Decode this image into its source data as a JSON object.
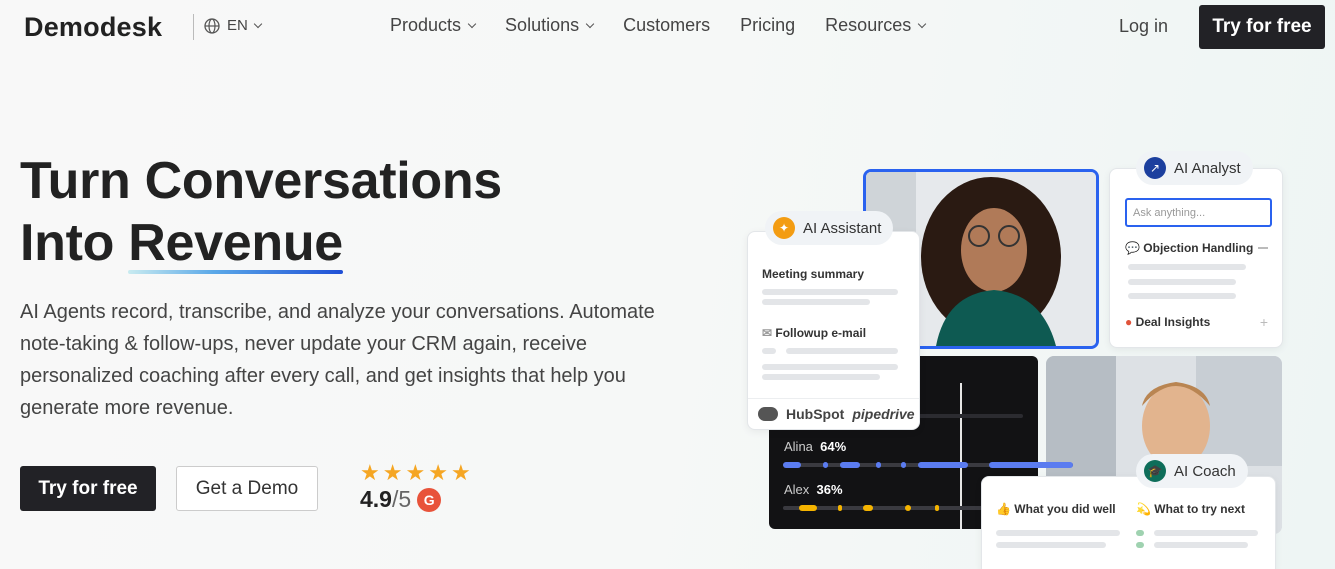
{
  "nav": {
    "logo": "Demodesk",
    "lang": "EN",
    "items": [
      {
        "label": "Products",
        "dropdown": true
      },
      {
        "label": "Solutions",
        "dropdown": true
      },
      {
        "label": "Customers",
        "dropdown": false
      },
      {
        "label": "Pricing",
        "dropdown": false
      },
      {
        "label": "Resources",
        "dropdown": true
      }
    ],
    "login": "Log in",
    "cta": "Try for free"
  },
  "hero": {
    "title_line1": "Turn Conversations",
    "title_line2_prefix": "Into ",
    "title_line2_highlight": "Revenue",
    "description": "AI Agents record, transcribe, and analyze your conversations. Automate note-taking & follow-ups, never update your CRM again, receive personalized coaching after every call, and get insights that help you generate more revenue.",
    "cta_primary": "Try for free",
    "cta_secondary": "Get a Demo",
    "rating_score": "4.9",
    "rating_out_of": "/5",
    "rating_stars": 5,
    "rating_badge": "G"
  },
  "assistant": {
    "pill": "AI Assistant",
    "meeting_summary": "Meeting summary",
    "followup": "Followup e-mail",
    "integrations": [
      "HubSpot",
      "pipedrive"
    ]
  },
  "analyst": {
    "pill": "AI Analyst",
    "placeholder": "Ask anything...",
    "objection": "Objection Handling",
    "deal": "Deal Insights"
  },
  "speakers": [
    {
      "name": "Alina",
      "pct": "64%"
    },
    {
      "name": "Alex",
      "pct": "36%"
    }
  ],
  "coach": {
    "pill": "AI Coach",
    "did_well": "What you did well",
    "try_next": "What to try next"
  },
  "colors": {
    "accent_blue": "#1f4fd6",
    "dark": "#222226",
    "alina_track": "#5b7cf0",
    "alex_track": "#f5b400",
    "star": "#f5a623"
  }
}
